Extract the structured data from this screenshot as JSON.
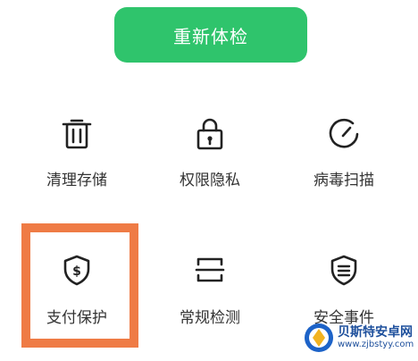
{
  "recheck_button": {
    "label": "重新体检"
  },
  "tools": [
    {
      "label": "清理存储",
      "icon": "trash-icon"
    },
    {
      "label": "权限隐私",
      "icon": "lock-icon"
    },
    {
      "label": "病毒扫描",
      "icon": "scan-gauge-icon"
    },
    {
      "label": "支付保护",
      "icon": "shield-dollar-icon"
    },
    {
      "label": "常规检测",
      "icon": "scan-frame-icon"
    },
    {
      "label": "安全事件",
      "icon": "shield-list-icon"
    }
  ],
  "highlight": {
    "color": "#ef7b45"
  },
  "colors": {
    "accent": "#2fc46c"
  },
  "watermark": {
    "brand": "贝斯特安卓网",
    "url": "www.zjbstyy.com"
  }
}
